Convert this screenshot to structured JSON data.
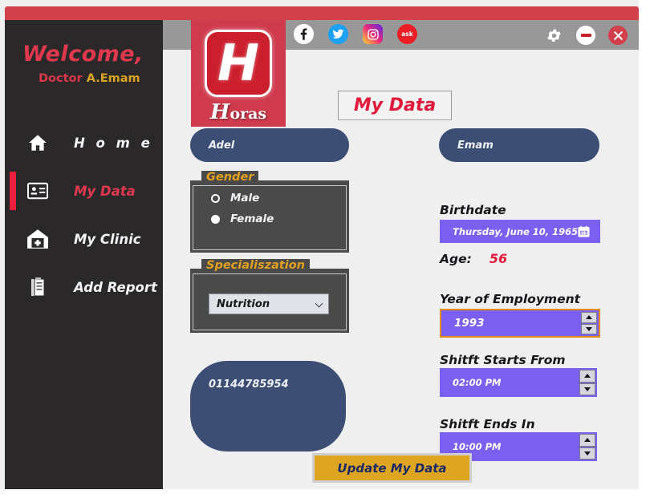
{
  "app": {
    "title_bar_color": "#d2404c",
    "logo": {
      "letter": "H",
      "word_cap": "H",
      "word_rest": "oras"
    }
  },
  "sidebar": {
    "welcome": "Welcome,",
    "doctor_prefix": "Doctor",
    "doctor_name": "A.Emam",
    "items": [
      {
        "label": "H o m e",
        "icon": "home-icon",
        "active": false
      },
      {
        "label": "My Data",
        "icon": "id-card-icon",
        "active": true
      },
      {
        "label": "My Clinic",
        "icon": "clinic-icon",
        "active": false
      },
      {
        "label": "Add Report",
        "icon": "clipboard-icon",
        "active": false
      }
    ]
  },
  "topbar": {
    "socials": [
      {
        "name": "facebook-icon",
        "label": "f"
      },
      {
        "name": "twitter-icon",
        "label": ""
      },
      {
        "name": "instagram-icon",
        "label": ""
      },
      {
        "name": "askfm-icon",
        "label": "ask"
      }
    ],
    "window_controls": [
      {
        "name": "settings-gear-button"
      },
      {
        "name": "minimize-button"
      },
      {
        "name": "close-button"
      }
    ]
  },
  "page": {
    "title": "My Data"
  },
  "form": {
    "first_name": "Adel",
    "last_name": "Emam",
    "phone": "01144785954",
    "gender": {
      "legend": "Gender",
      "options": [
        {
          "label": "Male",
          "checked": false
        },
        {
          "label": "Female",
          "checked": true
        }
      ]
    },
    "specialization": {
      "legend": "Specialiszation",
      "value": "Nutrition"
    },
    "birthdate": {
      "label": "Birthdate",
      "value": "Thursday, June 10, 1965"
    },
    "age": {
      "label": "Age:",
      "value": "56"
    },
    "year_of_employment": {
      "label": "Year of Employment",
      "value": "1993"
    },
    "shift_start": {
      "label": "Shitft Starts From",
      "value": "02:00 PM"
    },
    "shift_end": {
      "label": "Shitft Ends In",
      "value": "10:00 PM"
    },
    "update_button": "Update My Data"
  },
  "colors": {
    "accent_red": "#e0394f",
    "brand_red": "#cc1f2d",
    "sidebar_bg": "#2b2829",
    "pill_blue": "#3d4e75",
    "purple": "#7b5ff0",
    "gold": "#dda520",
    "legend_gold": "#e2a01c"
  }
}
